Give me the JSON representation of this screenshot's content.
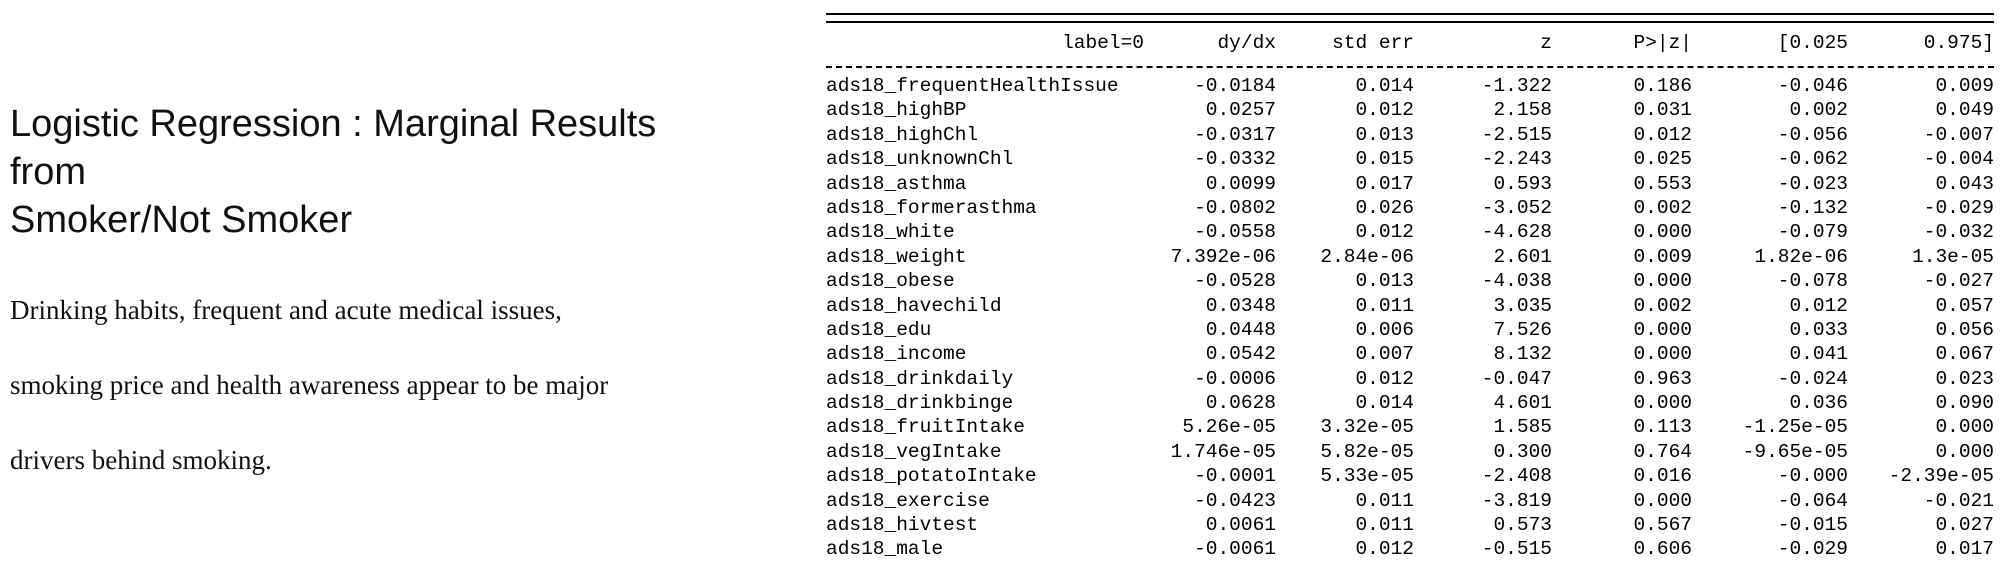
{
  "left_panel": {
    "title_lines": [
      "Logistic Regression : Marginal Results",
      "from",
      "Smoker/Not Smoker"
    ],
    "body_lines": [
      "Drinking habits, frequent and acute medical issues,",
      "smoking price and health awareness appear to be major",
      "drivers behind smoking."
    ]
  },
  "table": {
    "headers": {
      "label": "label=0",
      "dydx": "dy/dx",
      "std_err": "std err",
      "z": "z",
      "p": "P>|z|",
      "ci_low": "[0.025",
      "ci_high": "0.975]"
    },
    "rows": [
      {
        "name": "ads18_frequentHealthIssue",
        "dydx": "-0.0184",
        "std_err": "0.014",
        "z": "-1.322",
        "p": "0.186",
        "ci_low": "-0.046",
        "ci_high": "0.009"
      },
      {
        "name": "ads18_highBP",
        "dydx": "0.0257",
        "std_err": "0.012",
        "z": "2.158",
        "p": "0.031",
        "ci_low": "0.002",
        "ci_high": "0.049"
      },
      {
        "name": "ads18_highChl",
        "dydx": "-0.0317",
        "std_err": "0.013",
        "z": "-2.515",
        "p": "0.012",
        "ci_low": "-0.056",
        "ci_high": "-0.007"
      },
      {
        "name": "ads18_unknownChl",
        "dydx": "-0.0332",
        "std_err": "0.015",
        "z": "-2.243",
        "p": "0.025",
        "ci_low": "-0.062",
        "ci_high": "-0.004"
      },
      {
        "name": "ads18_asthma",
        "dydx": "0.0099",
        "std_err": "0.017",
        "z": "0.593",
        "p": "0.553",
        "ci_low": "-0.023",
        "ci_high": "0.043"
      },
      {
        "name": "ads18_formerasthma",
        "dydx": "-0.0802",
        "std_err": "0.026",
        "z": "-3.052",
        "p": "0.002",
        "ci_low": "-0.132",
        "ci_high": "-0.029"
      },
      {
        "name": "ads18_white",
        "dydx": "-0.0558",
        "std_err": "0.012",
        "z": "-4.628",
        "p": "0.000",
        "ci_low": "-0.079",
        "ci_high": "-0.032"
      },
      {
        "name": "ads18_weight",
        "dydx": "7.392e-06",
        "std_err": "2.84e-06",
        "z": "2.601",
        "p": "0.009",
        "ci_low": "1.82e-06",
        "ci_high": "1.3e-05"
      },
      {
        "name": "ads18_obese",
        "dydx": "-0.0528",
        "std_err": "0.013",
        "z": "-4.038",
        "p": "0.000",
        "ci_low": "-0.078",
        "ci_high": "-0.027"
      },
      {
        "name": "ads18_havechild",
        "dydx": "0.0348",
        "std_err": "0.011",
        "z": "3.035",
        "p": "0.002",
        "ci_low": "0.012",
        "ci_high": "0.057"
      },
      {
        "name": "ads18_edu",
        "dydx": "0.0448",
        "std_err": "0.006",
        "z": "7.526",
        "p": "0.000",
        "ci_low": "0.033",
        "ci_high": "0.056"
      },
      {
        "name": "ads18_income",
        "dydx": "0.0542",
        "std_err": "0.007",
        "z": "8.132",
        "p": "0.000",
        "ci_low": "0.041",
        "ci_high": "0.067"
      },
      {
        "name": "ads18_drinkdaily",
        "dydx": "-0.0006",
        "std_err": "0.012",
        "z": "-0.047",
        "p": "0.963",
        "ci_low": "-0.024",
        "ci_high": "0.023"
      },
      {
        "name": "ads18_drinkbinge",
        "dydx": "0.0628",
        "std_err": "0.014",
        "z": "4.601",
        "p": "0.000",
        "ci_low": "0.036",
        "ci_high": "0.090"
      },
      {
        "name": "ads18_fruitIntake",
        "dydx": "5.26e-05",
        "std_err": "3.32e-05",
        "z": "1.585",
        "p": "0.113",
        "ci_low": "-1.25e-05",
        "ci_high": "0.000"
      },
      {
        "name": "ads18_vegIntake",
        "dydx": "1.746e-05",
        "std_err": "5.82e-05",
        "z": "0.300",
        "p": "0.764",
        "ci_low": "-9.65e-05",
        "ci_high": "0.000"
      },
      {
        "name": "ads18_potatoIntake",
        "dydx": "-0.0001",
        "std_err": "5.33e-05",
        "z": "-2.408",
        "p": "0.016",
        "ci_low": "-0.000",
        "ci_high": "-2.39e-05"
      },
      {
        "name": "ads18_exercise",
        "dydx": "-0.0423",
        "std_err": "0.011",
        "z": "-3.819",
        "p": "0.000",
        "ci_low": "-0.064",
        "ci_high": "-0.021"
      },
      {
        "name": "ads18_hivtest",
        "dydx": "0.0061",
        "std_err": "0.011",
        "z": "0.573",
        "p": "0.567",
        "ci_low": "-0.015",
        "ci_high": "0.027"
      },
      {
        "name": "ads18_male",
        "dydx": "-0.0061",
        "std_err": "0.012",
        "z": "-0.515",
        "p": "0.606",
        "ci_low": "-0.029",
        "ci_high": "0.017"
      }
    ]
  }
}
